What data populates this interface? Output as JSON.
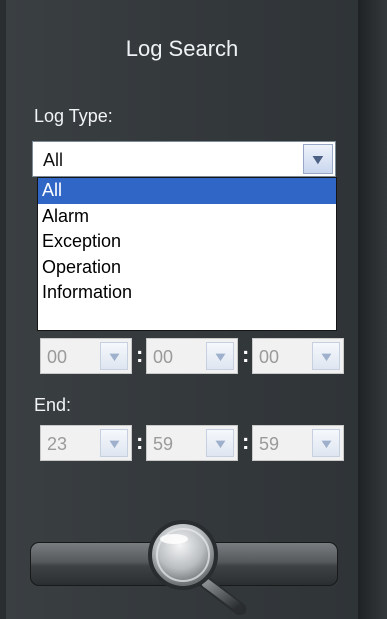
{
  "panel": {
    "title": "Log Search"
  },
  "log_type": {
    "label": "Log Type:",
    "selected": "All",
    "options": [
      "All",
      "Alarm",
      "Exception",
      "Operation",
      "Information"
    ]
  },
  "start_time": {
    "hour": "00",
    "minute": "00",
    "second": "00"
  },
  "end_time": {
    "label": "End:",
    "hour": "23",
    "minute": "59",
    "second": "59"
  },
  "time_separator": ":",
  "icons": {
    "dropdown": "chevron-down-icon",
    "search": "search-icon"
  },
  "colors": {
    "panel": "#353a3d",
    "selection": "#3067c6"
  }
}
